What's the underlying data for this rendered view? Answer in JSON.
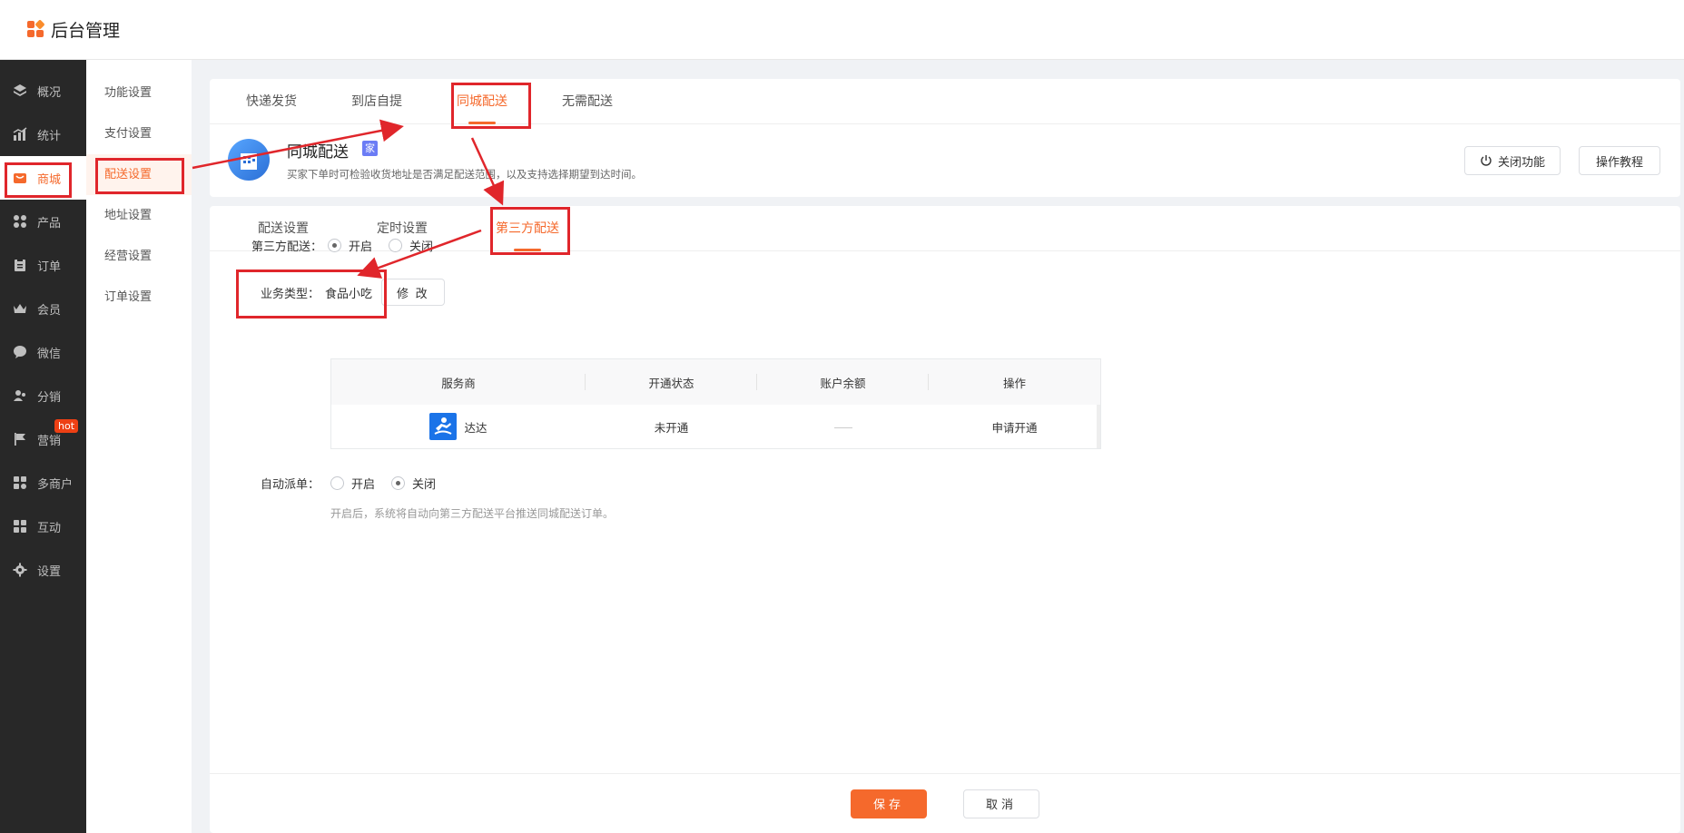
{
  "header": {
    "title": "后台管理"
  },
  "sidebar": {
    "items": [
      {
        "label": "概况",
        "icon": "layers-icon"
      },
      {
        "label": "统计",
        "icon": "chart-icon"
      },
      {
        "label": "商城",
        "icon": "shop-icon"
      },
      {
        "label": "产品",
        "icon": "grid-icon"
      },
      {
        "label": "订单",
        "icon": "clipboard-icon"
      },
      {
        "label": "会员",
        "icon": "crown-icon"
      },
      {
        "label": "微信",
        "icon": "wechat-icon"
      },
      {
        "label": "分销",
        "icon": "users-icon"
      },
      {
        "label": "营销",
        "icon": "flag-icon",
        "badge": "hot"
      },
      {
        "label": "多商户",
        "icon": "store-icon"
      },
      {
        "label": "互动",
        "icon": "apps-icon"
      },
      {
        "label": "设置",
        "icon": "gear-icon"
      }
    ],
    "active_index": 2
  },
  "subsidebar": {
    "items": [
      {
        "label": "功能设置"
      },
      {
        "label": "支付设置"
      },
      {
        "label": "配送设置"
      },
      {
        "label": "地址设置"
      },
      {
        "label": "经营设置"
      },
      {
        "label": "订单设置"
      }
    ],
    "active_index": 2
  },
  "delivery_tabs": [
    {
      "label": "快递发货"
    },
    {
      "label": "到店自提"
    },
    {
      "label": "同城配送"
    },
    {
      "label": "无需配送"
    }
  ],
  "feature": {
    "title": "同城配送",
    "tag": "家",
    "description": "买家下单时可检验收货地址是否满足配送范围，以及支持选择期望到达时间。",
    "close_button": "关闭功能",
    "tutorial_button": "操作教程"
  },
  "sub_tabs": [
    {
      "label": "配送设置"
    },
    {
      "label": "定时设置"
    },
    {
      "label": "第三方配送"
    }
  ],
  "form": {
    "third_party": {
      "label": "第三方配送：",
      "on_label": "开启",
      "off_label": "关闭",
      "value": "开启"
    },
    "business_type": {
      "label": "业务类型：",
      "value": "食品小吃",
      "edit_button": "修 改"
    },
    "table": {
      "headers": [
        "服务商",
        "开通状态",
        "账户余额",
        "操作"
      ],
      "rows": [
        {
          "provider": "达达",
          "status": "未开通",
          "balance": "—",
          "action": "申请开通"
        }
      ]
    },
    "auto_dispatch": {
      "label": "自动派单：",
      "on_label": "开启",
      "off_label": "关闭",
      "value": "关闭"
    },
    "hint": "开启后，系统将自动向第三方配送平台推送同城配送订单。"
  },
  "footer": {
    "save": "保存",
    "cancel": "取消"
  },
  "colors": {
    "accent": "#f5692c",
    "sidebar_bg": "#282828",
    "annotation": "#e0262b"
  }
}
